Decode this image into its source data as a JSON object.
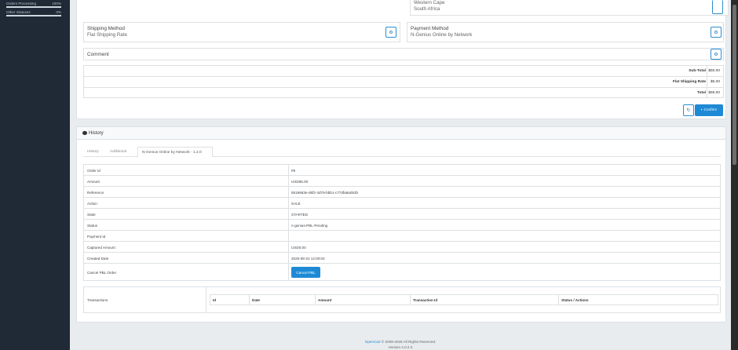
{
  "sidebar": {
    "stats": [
      {
        "label": "Orders Processing",
        "value": "100%"
      },
      {
        "label": "Other Statuses",
        "value": "0%"
      }
    ]
  },
  "address": {
    "line1": "Western Cape",
    "line2": "South Africa"
  },
  "shipping": {
    "title": "Shipping Method",
    "value": "Flat Shipping Rate"
  },
  "payment": {
    "title": "Payment Method",
    "value": "N-Genius Online by Network"
  },
  "comment": {
    "title": "Comment"
  },
  "totals": [
    {
      "label": "Sub-Total",
      "value": "$60.00"
    },
    {
      "label": "Flat Shipping Rate",
      "value": "$5.00"
    },
    {
      "label": "Total",
      "value": "$65.00"
    }
  ],
  "actions": {
    "confirm": "Confirm"
  },
  "history": {
    "title": "History",
    "tabs": [
      "History",
      "Additional",
      "N-Genius Online by Network - 1.2.0"
    ]
  },
  "order_info": [
    {
      "label": "Order Id",
      "value": "#9"
    },
    {
      "label": "Amount",
      "value": "USD65.00"
    },
    {
      "label": "Reference",
      "value": "5519663e-d6f2-4d76-bbb1-c77dfa8a052b"
    },
    {
      "label": "Action",
      "value": "SALE"
    },
    {
      "label": "State",
      "value": "STARTED"
    },
    {
      "label": "Status",
      "value": "n-genius-PBL-Pending"
    },
    {
      "label": "Payment Id",
      "value": ""
    },
    {
      "label": "Captured Amount",
      "value": "USD0.00"
    },
    {
      "label": "Created Date",
      "value": "2025-08-22 12:00:04"
    }
  ],
  "cancel": {
    "label": "Cancel PBL Order",
    "button": "Cancel PBL"
  },
  "transactions": {
    "label": "Transactions",
    "columns": [
      "Id",
      "Date",
      "Amount",
      "Transaction Id",
      "Status / Actions"
    ]
  },
  "footer": {
    "brand": "OpenCart",
    "copyright": "© 2009-2025 All Rights Reserved.",
    "version": "Version 4.0.2.3"
  },
  "colors": {
    "primary": "#1e8ad6",
    "sidebar": "#1f2a36"
  }
}
